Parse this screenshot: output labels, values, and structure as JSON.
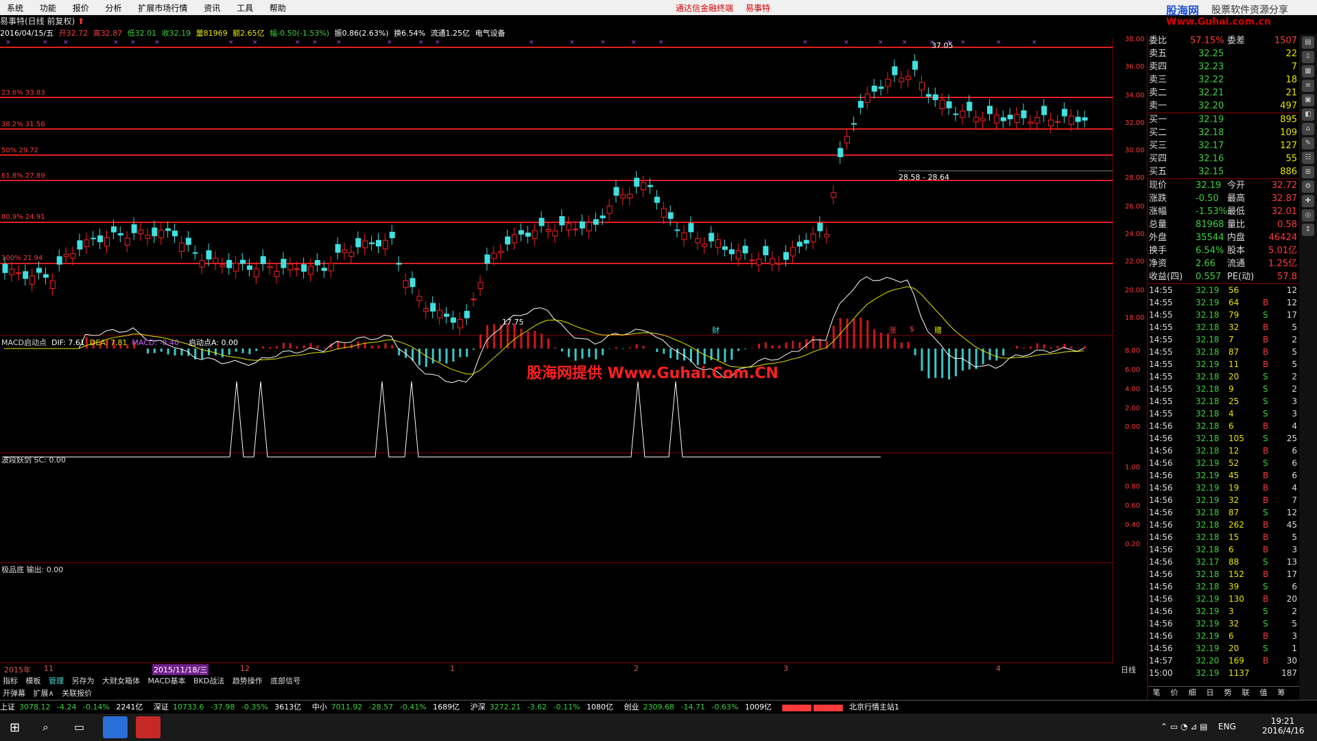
{
  "menu": {
    "items": [
      "系统",
      "功能",
      "报价",
      "分析",
      "扩展市场行情",
      "资讯",
      "工具",
      "帮助"
    ],
    "center": [
      "通达信金融终端",
      "易事特"
    ],
    "logo_main": "股海网",
    "logo_sub": "股票软件资源分享",
    "logo_url": "Www.Guhai.com.cn"
  },
  "title": {
    "text": "易事特(日线 前复权)",
    "arrow": "⬆"
  },
  "info": {
    "date": "2016/04/15/五",
    "open": "开32.72",
    "high": "高32.87",
    "low": "低32.01",
    "close": "收32.19",
    "vol": "量81969",
    "amt": "额2.65亿",
    "chg": "幅-0.50(-1.53%)",
    "amp": "振0.86(2.63%)",
    "turn": "换6.54%",
    "float": "流通1.25亿",
    "industry": "电气设备"
  },
  "price_axis": [
    "38.00",
    "36.00",
    "34.00",
    "32.00",
    "30.00",
    "28.00",
    "26.00",
    "24.00",
    "22.00",
    "20.00",
    "18.00"
  ],
  "fib_labels": [
    "23.6% 33.83",
    "38.2% 31.56",
    "50% 29.72",
    "61.8% 27.89",
    "80.9% 24.91",
    "100% 21.94"
  ],
  "price_annotations": {
    "high": "37.05",
    "low": "17.75",
    "range": "28.58 - 28.64"
  },
  "event_labels": [
    "财",
    "涨",
    "$",
    "赠"
  ],
  "macd_panel": {
    "label": "MACD启动点",
    "dif": "DIF: 7.61",
    "dea": "DEA: 7.81",
    "macd": "MACD: -0.40",
    "start": "启动点A: 0.00",
    "axis": [
      "8.00",
      "6.00",
      "4.00",
      "2.00",
      "0.00"
    ]
  },
  "watermark": "股海网提供 Www.Guhai.Com.CN",
  "wave_panel": {
    "label": "波段妖剑  SC: 0.00",
    "axis": [
      "1.00",
      "0.80",
      "0.60",
      "0.40",
      "0.20"
    ]
  },
  "bottom_panel": {
    "label": "极品底  输出: 0.00"
  },
  "date_axis": {
    "labels": [
      "2015年",
      "11",
      "2015/11/18/三",
      "12",
      "1",
      "2",
      "3",
      "4"
    ],
    "period": "日线"
  },
  "tabs": [
    "指标",
    "模板",
    "管理",
    "另存为",
    "大财女箱体",
    "MACD基本",
    "BKD战法",
    "趋势操作",
    "底部信号"
  ],
  "tabs2": [
    "开弹幕",
    "扩展∧",
    "关联报价"
  ],
  "quote": {
    "weibi": "委比",
    "weibi_val": "57.15%",
    "weicha": "委差",
    "weicha_val": "1507",
    "asks": [
      [
        "卖五",
        "32.25",
        "22"
      ],
      [
        "卖四",
        "32.23",
        "7"
      ],
      [
        "卖三",
        "32.22",
        "18"
      ],
      [
        "卖二",
        "32.21",
        "21"
      ],
      [
        "卖一",
        "32.20",
        "497"
      ]
    ],
    "bids": [
      [
        "买一",
        "32.19",
        "895"
      ],
      [
        "买二",
        "32.18",
        "109"
      ],
      [
        "买三",
        "32.17",
        "127"
      ],
      [
        "买四",
        "32.16",
        "55"
      ],
      [
        "买五",
        "32.15",
        "886"
      ]
    ],
    "stats": [
      [
        "现价",
        "32.19",
        "今开",
        "32.72"
      ],
      [
        "涨跌",
        "-0.50",
        "最高",
        "32.87"
      ],
      [
        "涨幅",
        "-1.53%",
        "最低",
        "32.01"
      ],
      [
        "总量",
        "81968",
        "量比",
        "0.58"
      ],
      [
        "外盘",
        "35544",
        "内盘",
        "46424"
      ],
      [
        "换手",
        "6.54%",
        "股本",
        "5.01亿"
      ],
      [
        "净资",
        "2.66",
        "流通",
        "1.25亿"
      ],
      [
        "收益(四)",
        "0.557",
        "PE(动)",
        "57.8"
      ]
    ]
  },
  "ticks": [
    [
      "14:55",
      "32.19",
      "56",
      "",
      "12"
    ],
    [
      "14:55",
      "32.19",
      "64",
      "B",
      "12"
    ],
    [
      "14:55",
      "32.18",
      "79",
      "S",
      "17"
    ],
    [
      "14:55",
      "32.18",
      "32",
      "B",
      "5"
    ],
    [
      "14:55",
      "32.18",
      "7",
      "B",
      "2"
    ],
    [
      "14:55",
      "32.18",
      "87",
      "B",
      "5"
    ],
    [
      "14:55",
      "32.19",
      "11",
      "B",
      "5"
    ],
    [
      "14:55",
      "32.18",
      "20",
      "S",
      "2"
    ],
    [
      "14:55",
      "32.18",
      "9",
      "S",
      "2"
    ],
    [
      "14:55",
      "32.18",
      "25",
      "S",
      "3"
    ],
    [
      "14:55",
      "32.18",
      "4",
      "S",
      "3"
    ],
    [
      "14:56",
      "32.18",
      "6",
      "B",
      "4"
    ],
    [
      "14:56",
      "32.18",
      "105",
      "S",
      "25"
    ],
    [
      "14:56",
      "32.18",
      "12",
      "B",
      "6"
    ],
    [
      "14:56",
      "32.19",
      "52",
      "S",
      "6"
    ],
    [
      "14:56",
      "32.19",
      "45",
      "B",
      "6"
    ],
    [
      "14:56",
      "32.19",
      "19",
      "B",
      "4"
    ],
    [
      "14:56",
      "32.19",
      "32",
      "B",
      "7"
    ],
    [
      "14:56",
      "32.18",
      "87",
      "S",
      "12"
    ],
    [
      "14:56",
      "32.18",
      "262",
      "B",
      "45"
    ],
    [
      "14:56",
      "32.18",
      "15",
      "B",
      "5"
    ],
    [
      "14:56",
      "32.18",
      "6",
      "B",
      "3"
    ],
    [
      "14:56",
      "32.17",
      "88",
      "S",
      "13"
    ],
    [
      "14:56",
      "32.18",
      "152",
      "B",
      "17"
    ],
    [
      "14:56",
      "32.18",
      "39",
      "S",
      "6"
    ],
    [
      "14:56",
      "32.19",
      "130",
      "B",
      "20"
    ],
    [
      "14:56",
      "32.19",
      "3",
      "S",
      "2"
    ],
    [
      "14:56",
      "32.19",
      "32",
      "S",
      "5"
    ],
    [
      "14:56",
      "32.19",
      "6",
      "B",
      "3"
    ],
    [
      "14:56",
      "32.19",
      "20",
      "S",
      "1"
    ],
    [
      "14:57",
      "32.20",
      "169",
      "B",
      "30"
    ],
    [
      "15:00",
      "32.19",
      "1137",
      "",
      "187"
    ]
  ],
  "side_tabs": [
    "笔",
    "价",
    "细",
    "日",
    "势",
    "联",
    "值",
    "筹"
  ],
  "status": {
    "sh": [
      "上证",
      "3078.12",
      "-4.24",
      "-0.14%",
      "2241亿"
    ],
    "sz": [
      "深证",
      "10733.6",
      "-37.98",
      "-0.35%",
      "3613亿"
    ],
    "zx": [
      "中小",
      "7011.92",
      "-28.57",
      "-0.41%",
      "1689亿"
    ],
    "hs": [
      "沪深",
      "3272.21",
      "-3.62",
      "-0.11%",
      "1080亿"
    ],
    "cy": [
      "创业",
      "2309.68",
      "-14.71",
      "-0.63%",
      "1009亿"
    ],
    "server": "北京行情主站1"
  },
  "taskbar": {
    "lang": "ENG",
    "time": "19:21",
    "date": "2016/4/16"
  }
}
